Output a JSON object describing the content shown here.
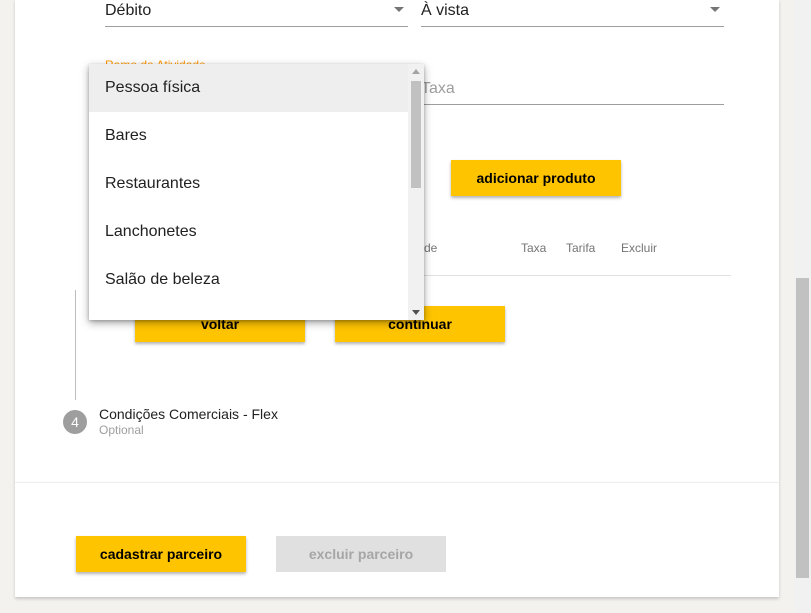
{
  "form": {
    "payment_type": "Débito",
    "payment_term": "À vista",
    "activity_label": "Ramo de Atividade",
    "rate_placeholder": "Taxa",
    "add_product_label": "adicionar produto"
  },
  "table": {
    "headers": [
      "de",
      "Taxa",
      "Tarifa",
      "Excluir"
    ]
  },
  "buttons": {
    "back_label": "voltar",
    "continue_label": "continuar",
    "register_label": "cadastrar parceiro",
    "delete_label": "excluir parceiro"
  },
  "step4": {
    "number": "4",
    "title": "Condições Comerciais - Flex",
    "subtitle": "Optional"
  },
  "dropdown": {
    "items": [
      "Pessoa física",
      "Bares",
      "Restaurantes",
      "Lanchonetes",
      "Salão de beleza"
    ],
    "selected_index": 0
  },
  "colors": {
    "accent": "#ffc400",
    "label_orange": "#ff9800",
    "disabled_bg": "#e0e0e0"
  }
}
